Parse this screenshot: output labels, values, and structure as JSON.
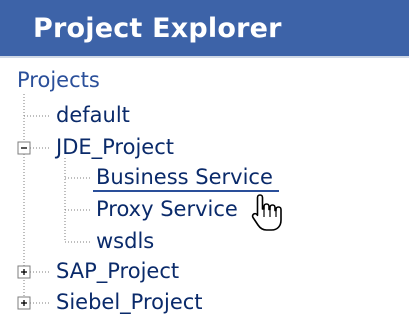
{
  "header": {
    "title": "Project Explorer"
  },
  "tree": {
    "root_label": "Projects",
    "items": [
      {
        "label": "default"
      },
      {
        "label": "JDE_Project",
        "expanded": true,
        "children": [
          {
            "label": "Business Service",
            "selected": true
          },
          {
            "label": "Proxy Service"
          },
          {
            "label": "wsdls"
          }
        ]
      },
      {
        "label": "SAP_Project",
        "expanded": false
      },
      {
        "label": "Siebel_Project",
        "expanded": false
      }
    ]
  },
  "icons": {
    "expanded": "minus-box-icon",
    "collapsed": "plus-box-icon",
    "cursor": "hand-pointer-icon"
  },
  "colors": {
    "header_bg": "#3d63a8",
    "header_text": "#ffffff",
    "tree_text": "#0a2a6a",
    "tree_lines": "#7d7d7d"
  }
}
